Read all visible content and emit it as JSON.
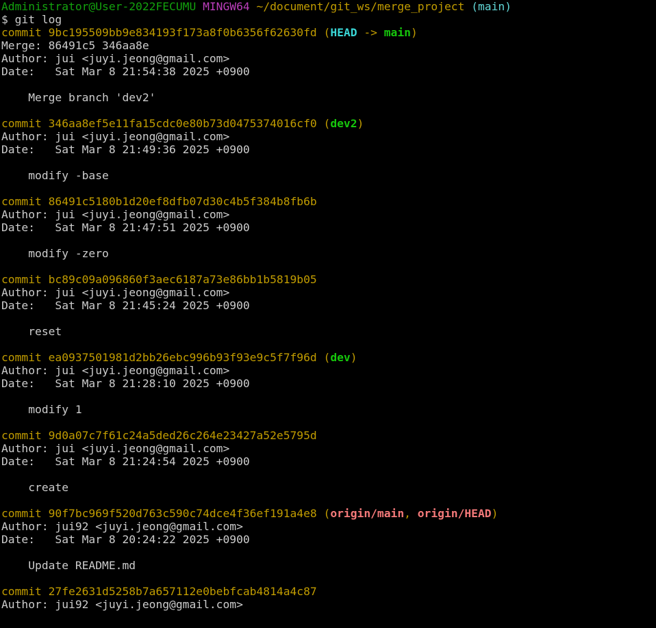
{
  "colors": {
    "background": "#000000",
    "text": "#cccccc",
    "user_host": "#13a10e",
    "mingw": "#bc3fbc",
    "path": "#c19c00",
    "commit": "#c19c00",
    "branch_paren": "#61d6d6",
    "head_ref": "#3ad6d6",
    "local_branch": "#16c60c",
    "remote_branch": "#f57a7a"
  },
  "lines": [
    {
      "segs": [
        [
          "Administrator@User-2022FECUMU",
          "green"
        ],
        [
          " ",
          "white"
        ],
        [
          "MINGW64",
          "purple"
        ],
        [
          " ",
          "white"
        ],
        [
          "~/document/git_ws/merge_project",
          "yellow"
        ],
        [
          " ",
          "white"
        ],
        [
          "(main)",
          "cyan"
        ]
      ]
    },
    {
      "segs": [
        [
          "$ git log",
          "white"
        ]
      ]
    },
    {
      "segs": [
        [
          "commit 9bc195509bb9e834193f173a8f0b6356f62630fd",
          "yellow"
        ],
        [
          " (",
          "yellow"
        ],
        [
          "HEAD",
          "bcyan"
        ],
        [
          " -> ",
          "yellow"
        ],
        [
          "main",
          "bgreen"
        ],
        [
          ")",
          "yellow"
        ]
      ]
    },
    {
      "segs": [
        [
          "Merge: 86491c5 346aa8e",
          "white"
        ]
      ]
    },
    {
      "segs": [
        [
          "Author: jui <juyi.jeong@gmail.com>",
          "white"
        ]
      ]
    },
    {
      "segs": [
        [
          "Date:   Sat Mar 8 21:54:38 2025 +0900",
          "white"
        ]
      ]
    },
    {
      "segs": [
        [
          "",
          "white"
        ]
      ]
    },
    {
      "segs": [
        [
          "    Merge branch 'dev2'",
          "white"
        ]
      ]
    },
    {
      "segs": [
        [
          "",
          "white"
        ]
      ]
    },
    {
      "segs": [
        [
          "commit 346aa8ef5e11fa15cdc0e80b73d0475374016cf0",
          "yellow"
        ],
        [
          " (",
          "yellow"
        ],
        [
          "dev2",
          "bgreen"
        ],
        [
          ")",
          "yellow"
        ]
      ]
    },
    {
      "segs": [
        [
          "Author: jui <juyi.jeong@gmail.com>",
          "white"
        ]
      ]
    },
    {
      "segs": [
        [
          "Date:   Sat Mar 8 21:49:36 2025 +0900",
          "white"
        ]
      ]
    },
    {
      "segs": [
        [
          "",
          "white"
        ]
      ]
    },
    {
      "segs": [
        [
          "    modify -base",
          "white"
        ]
      ]
    },
    {
      "segs": [
        [
          "",
          "white"
        ]
      ]
    },
    {
      "segs": [
        [
          "commit 86491c5180b1d20ef8dfb07d30c4b5f384b8fb6b",
          "yellow"
        ]
      ]
    },
    {
      "segs": [
        [
          "Author: jui <juyi.jeong@gmail.com>",
          "white"
        ]
      ]
    },
    {
      "segs": [
        [
          "Date:   Sat Mar 8 21:47:51 2025 +0900",
          "white"
        ]
      ]
    },
    {
      "segs": [
        [
          "",
          "white"
        ]
      ]
    },
    {
      "segs": [
        [
          "    modify -zero",
          "white"
        ]
      ]
    },
    {
      "segs": [
        [
          "",
          "white"
        ]
      ]
    },
    {
      "segs": [
        [
          "commit bc89c09a096860f3aec6187a73e86bb1b5819b05",
          "yellow"
        ]
      ]
    },
    {
      "segs": [
        [
          "Author: jui <juyi.jeong@gmail.com>",
          "white"
        ]
      ]
    },
    {
      "segs": [
        [
          "Date:   Sat Mar 8 21:45:24 2025 +0900",
          "white"
        ]
      ]
    },
    {
      "segs": [
        [
          "",
          "white"
        ]
      ]
    },
    {
      "segs": [
        [
          "    reset",
          "white"
        ]
      ]
    },
    {
      "segs": [
        [
          "",
          "white"
        ]
      ]
    },
    {
      "segs": [
        [
          "commit ea0937501981d2bb26ebc996b93f93e9c5f7f96d",
          "yellow"
        ],
        [
          " (",
          "yellow"
        ],
        [
          "dev",
          "bgreen"
        ],
        [
          ")",
          "yellow"
        ]
      ]
    },
    {
      "segs": [
        [
          "Author: jui <juyi.jeong@gmail.com>",
          "white"
        ]
      ]
    },
    {
      "segs": [
        [
          "Date:   Sat Mar 8 21:28:10 2025 +0900",
          "white"
        ]
      ]
    },
    {
      "segs": [
        [
          "",
          "white"
        ]
      ]
    },
    {
      "segs": [
        [
          "    modify 1",
          "white"
        ]
      ]
    },
    {
      "segs": [
        [
          "",
          "white"
        ]
      ]
    },
    {
      "segs": [
        [
          "commit 9d0a07c7f61c24a5ded26c264e23427a52e5795d",
          "yellow"
        ]
      ]
    },
    {
      "segs": [
        [
          "Author: jui <juyi.jeong@gmail.com>",
          "white"
        ]
      ]
    },
    {
      "segs": [
        [
          "Date:   Sat Mar 8 21:24:54 2025 +0900",
          "white"
        ]
      ]
    },
    {
      "segs": [
        [
          "",
          "white"
        ]
      ]
    },
    {
      "segs": [
        [
          "    create",
          "white"
        ]
      ]
    },
    {
      "segs": [
        [
          "",
          "white"
        ]
      ]
    },
    {
      "segs": [
        [
          "commit 90f7bc969f520d763c590c74dce4f36ef191a4e8",
          "yellow"
        ],
        [
          " (",
          "yellow"
        ],
        [
          "origin/main",
          "bred"
        ],
        [
          ", ",
          "yellow"
        ],
        [
          "origin/HEAD",
          "bred"
        ],
        [
          ")",
          "yellow"
        ]
      ]
    },
    {
      "segs": [
        [
          "Author: jui92 <juyi.jeong@gmail.com>",
          "white"
        ]
      ]
    },
    {
      "segs": [
        [
          "Date:   Sat Mar 8 20:24:22 2025 +0900",
          "white"
        ]
      ]
    },
    {
      "segs": [
        [
          "",
          "white"
        ]
      ]
    },
    {
      "segs": [
        [
          "    Update README.md",
          "white"
        ]
      ]
    },
    {
      "segs": [
        [
          "",
          "white"
        ]
      ]
    },
    {
      "segs": [
        [
          "commit 27fe2631d5258b7a657112e0bebfcab4814a4c87",
          "yellow"
        ]
      ]
    },
    {
      "segs": [
        [
          "Author: jui92 <juyi.jeong@gmail.com>",
          "white"
        ]
      ]
    }
  ]
}
